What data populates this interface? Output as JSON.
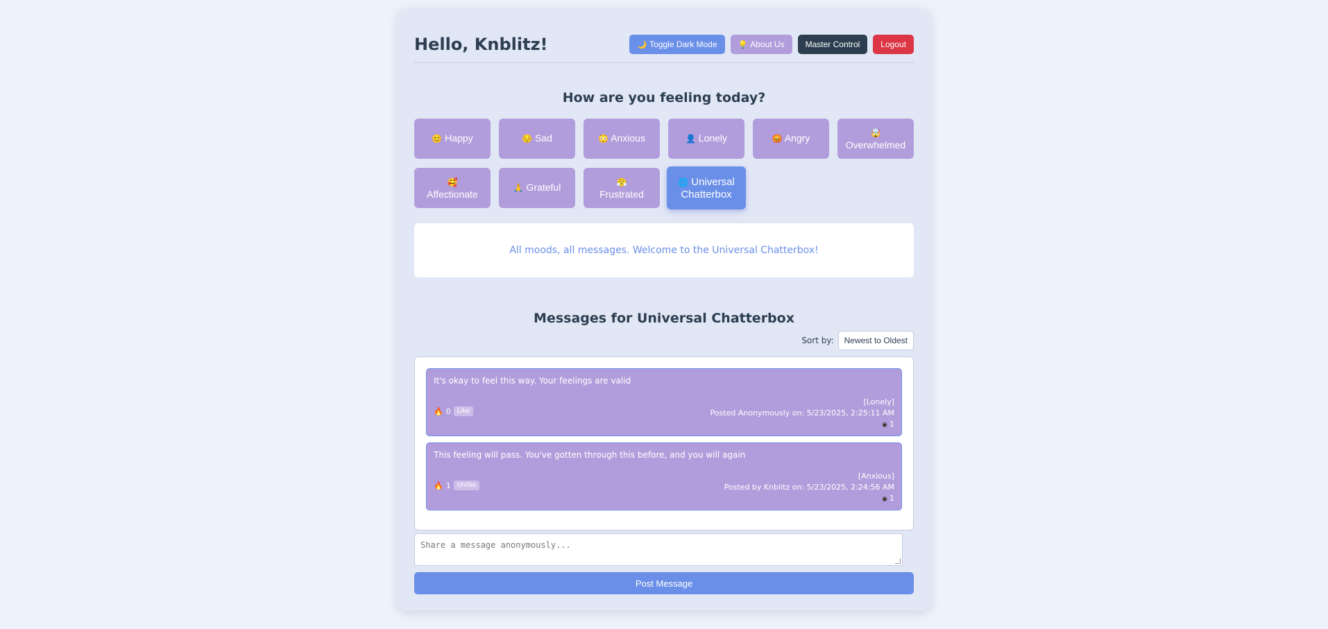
{
  "header": {
    "greeting": "Hello, Knblitz!",
    "buttons": {
      "dark_mode": {
        "icon": "🌙",
        "label": "Toggle Dark Mode"
      },
      "about": {
        "icon": "💡",
        "label": "About Us"
      },
      "master": {
        "label": "Master Control"
      },
      "logout": {
        "label": "Logout"
      }
    }
  },
  "mood_prompt": "How are you feeling today?",
  "moods": [
    {
      "icon": "😊",
      "label": "Happy"
    },
    {
      "icon": "😔",
      "label": "Sad"
    },
    {
      "icon": "😳",
      "label": "Anxious"
    },
    {
      "icon": "👤",
      "label": "Lonely"
    },
    {
      "icon": "😡",
      "label": "Angry"
    },
    {
      "icon": "🤯",
      "label": "Overwhelmed"
    },
    {
      "icon": "🥰",
      "label": "Affectionate"
    },
    {
      "icon": "🙏",
      "label": "Grateful"
    },
    {
      "icon": "😤",
      "label": "Frustrated"
    },
    {
      "icon": "🌐",
      "label": "Universal Chatterbox",
      "active": true
    }
  ],
  "welcome_text": "All moods, all messages. Welcome to the Universal Chatterbox!",
  "messages_title": "Messages for Universal Chatterbox",
  "sort": {
    "label": "Sort by:",
    "selected": "Newest to Oldest"
  },
  "messages": [
    {
      "text": "It's okay to feel this way. Your feelings are valid",
      "mood_tag": "[Lonely]",
      "posted": "Posted Anonymously on: 5/23/2025, 2:25:11 AM",
      "views": "1",
      "likes": "0",
      "like_label": "Like"
    },
    {
      "text": "This feeling will pass. You've gotten through this before, and you will again",
      "mood_tag": "[Anxious]",
      "posted": "Posted by Knblitz on: 5/23/2025, 2:24:56 AM",
      "views": "1",
      "likes": "1",
      "like_label": "Unlike"
    }
  ],
  "composer": {
    "placeholder": "Share a message anonymously...",
    "post_label": "Post Message"
  },
  "colors": {
    "accent": "#6a8fe8",
    "mood_purple": "#b19ddb",
    "dark": "#2c3e50",
    "danger": "#dc3545"
  }
}
